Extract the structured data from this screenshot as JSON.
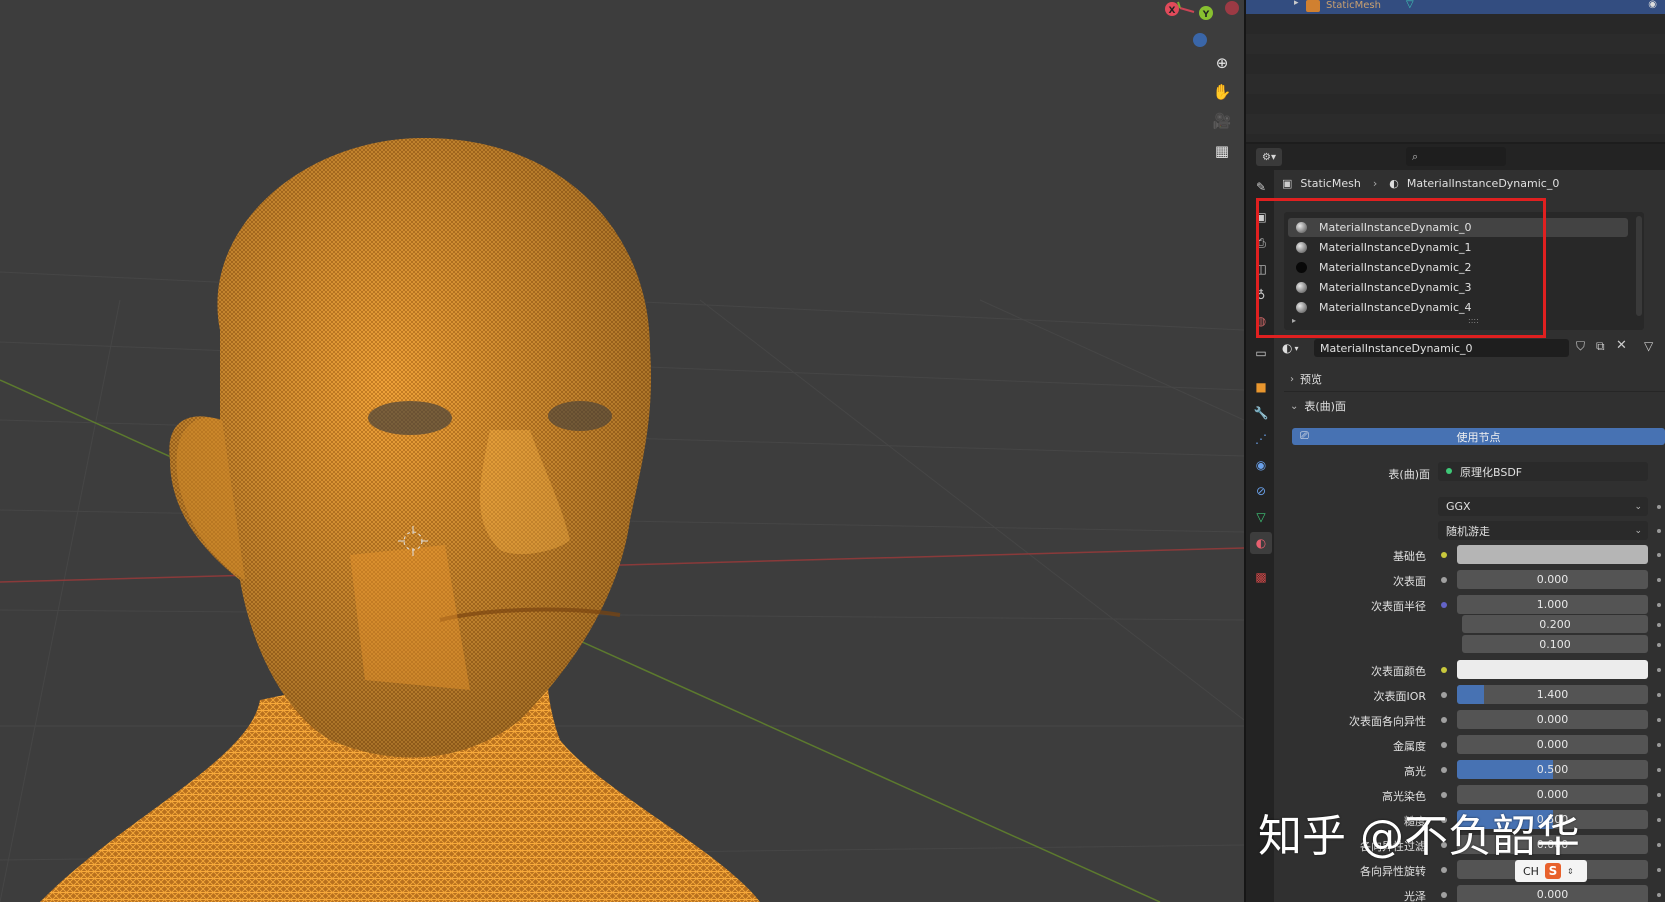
{
  "outliner": {
    "selected_row_label": "StaticMesh"
  },
  "props_header": {
    "search_placeholder": ""
  },
  "breadcrumb": {
    "object": "StaticMesh",
    "material": "MaterialInstanceDynamic_0"
  },
  "material_slots": [
    {
      "name": "MaterialInstanceDynamic_0",
      "ball": "grey",
      "selected": true
    },
    {
      "name": "MaterialInstanceDynamic_1",
      "ball": "grey",
      "selected": false
    },
    {
      "name": "MaterialInstanceDynamic_2",
      "ball": "black",
      "selected": false
    },
    {
      "name": "MaterialInstanceDynamic_3",
      "ball": "grey",
      "selected": false
    },
    {
      "name": "MaterialInstanceDynamic_4",
      "ball": "grey",
      "selected": false
    }
  ],
  "material_selector": {
    "name": "MaterialInstanceDynamic_0"
  },
  "sections": {
    "preview": "预览",
    "surface": "表(曲)面"
  },
  "use_nodes_label": "使用节点",
  "surface_row": {
    "label": "表(曲)面",
    "value": "原理化BSDF"
  },
  "distribution": "GGX",
  "subsurface_method": "随机游走",
  "properties": [
    {
      "label": "基础色",
      "value": "",
      "socket": "#c8c83c",
      "kind": "color",
      "color": "#b5b5b5"
    },
    {
      "label": "次表面",
      "value": "0.000",
      "socket": "#a0a0a0",
      "kind": "number",
      "fill": 0
    },
    {
      "label": "次表面半径",
      "value": "1.000",
      "socket": "#6363c7",
      "kind": "number",
      "fill": 0
    },
    {
      "label": "",
      "value": "0.200",
      "kind": "number",
      "fill": 0
    },
    {
      "label": "",
      "value": "0.100",
      "kind": "number",
      "fill": 0
    },
    {
      "label": "次表面颜色",
      "value": "",
      "socket": "#c8c83c",
      "kind": "color",
      "color": "#ececec"
    },
    {
      "label": "次表面IOR",
      "value": "1.400",
      "socket": "#a0a0a0",
      "kind": "number",
      "fill": 0.14
    },
    {
      "label": "次表面各向异性",
      "value": "0.000",
      "socket": "#a0a0a0",
      "kind": "number",
      "fill": 0
    },
    {
      "label": "金属度",
      "value": "0.000",
      "socket": "#a0a0a0",
      "kind": "number",
      "fill": 0
    },
    {
      "label": "高光",
      "value": "0.500",
      "socket": "#a0a0a0",
      "kind": "number",
      "fill": 0.5
    },
    {
      "label": "高光染色",
      "value": "0.000",
      "socket": "#a0a0a0",
      "kind": "number",
      "fill": 0
    },
    {
      "label": "糙度",
      "value": "0.500",
      "socket": "#a0a0a0",
      "kind": "number",
      "fill": 0.5
    },
    {
      "label": "各向异性过滤",
      "value": "0.000",
      "socket": "#a0a0a0",
      "kind": "number",
      "fill": 0
    },
    {
      "label": "各向异性旋转",
      "value": "0.000",
      "socket": "#a0a0a0",
      "kind": "number",
      "fill": 0
    },
    {
      "label": "光泽",
      "value": "0.000",
      "socket": "#a0a0a0",
      "kind": "number",
      "fill": 0
    }
  ],
  "gizmo": {
    "x": "X",
    "y": "Y"
  },
  "watermark": "知乎 @不负韶华",
  "ime": {
    "label": "CH"
  },
  "colors": {
    "viewport_bg": "#3d3d3d",
    "wireframe": "#f0a030",
    "accent": "#4772b3",
    "highlight_box": "#e02020"
  }
}
